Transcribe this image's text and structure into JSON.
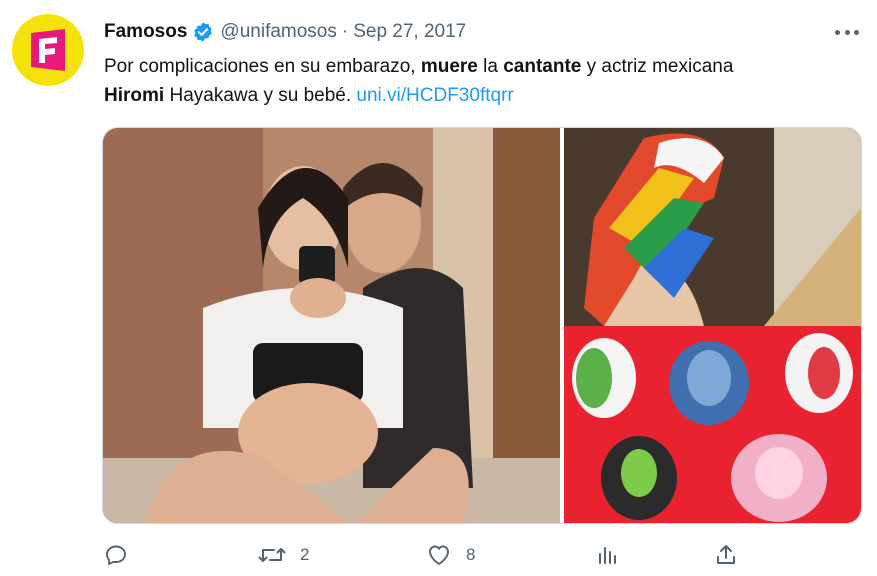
{
  "account": {
    "name": "Famosos",
    "handle": "@unifamosos",
    "separator": "·",
    "date": "Sep 27, 2017",
    "avatar_letter": "F",
    "avatar_bg": "#f5e20a",
    "avatar_fg": "#e8197b"
  },
  "tweet": {
    "p1": "Por complicaciones en su embarazo, ",
    "b1": "muere",
    "p2": " la ",
    "b2": "cantante",
    "p3": " y actriz mexicana ",
    "b3": "Hiromi",
    "p4": " Hayakawa y su bebé. ",
    "link": "uni.vi/HCDF30ftqrr"
  },
  "media": {
    "left_photo": "couple-pregnancy-selfie",
    "right_photo": "baby-shoes-collage"
  },
  "actions": {
    "reply_icon": "comment-icon",
    "retweet_icon": "retweet-icon",
    "retweet_count": "2",
    "like_icon": "heart-icon",
    "like_count": "8",
    "views_icon": "analytics-icon",
    "share_icon": "share-icon"
  },
  "colors": {
    "link": "#1d9bf0",
    "muted": "#536471",
    "verified": "#1d9bf0"
  }
}
